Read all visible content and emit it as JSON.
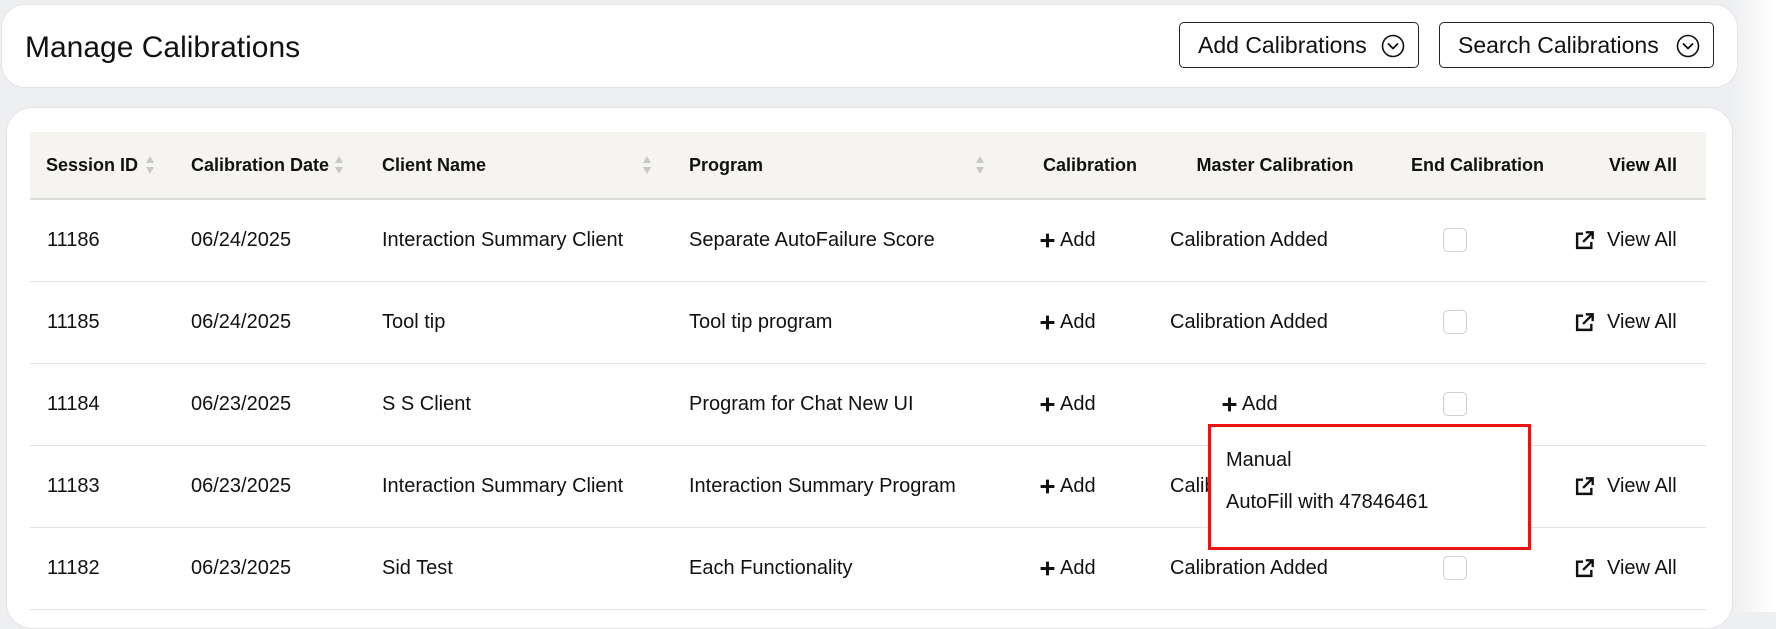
{
  "header": {
    "title": "Manage Calibrations",
    "add_button": "Add Calibrations",
    "search_button": "Search Calibrations"
  },
  "table": {
    "columns": [
      "Session ID",
      "Calibration Date",
      "Client Name",
      "Program",
      "Calibration",
      "Master Calibration",
      "End Calibration",
      "View All"
    ],
    "rows": [
      {
        "session_id": "11186",
        "date": "06/24/2025",
        "client": "Interaction Summary Client",
        "program": "Separate AutoFailure Score",
        "calibration": "Add",
        "master": "Calibration Added",
        "view_all": "View All"
      },
      {
        "session_id": "11185",
        "date": "06/24/2025",
        "client": "Tool tip",
        "program": "Tool tip program",
        "calibration": "Add",
        "master": "Calibration Added",
        "view_all": "View All"
      },
      {
        "session_id": "11184",
        "date": "06/23/2025",
        "client": "S S Client",
        "program": "Program for Chat New UI",
        "calibration": "Add",
        "master": "Add",
        "view_all": ""
      },
      {
        "session_id": "11183",
        "date": "06/23/2025",
        "client": "Interaction Summary Client",
        "program": "Interaction Summary Program",
        "calibration": "Add",
        "master": "Calib",
        "view_all": "View All"
      },
      {
        "session_id": "11182",
        "date": "06/23/2025",
        "client": "Sid Test",
        "program": "Each Functionality",
        "calibration": "Add",
        "master": "Calibration Added",
        "view_all": "View All"
      }
    ]
  },
  "dropdown": {
    "options": [
      "Manual",
      "AutoFill with 47846461"
    ]
  },
  "colors": {
    "highlight_border": "#ee1111",
    "header_bg": "#f5f4f1"
  }
}
